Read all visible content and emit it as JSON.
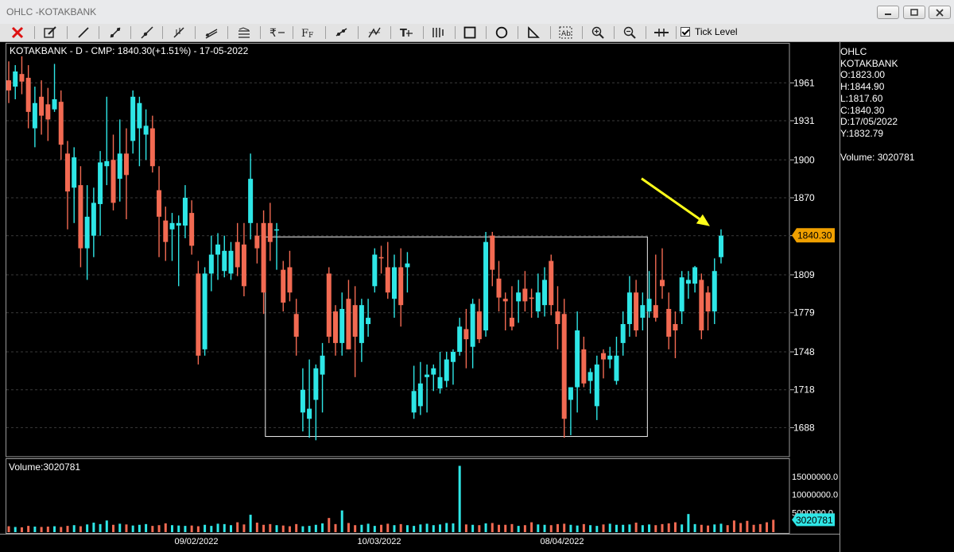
{
  "window": {
    "title": "OHLC -KOTAKBANK",
    "controls": [
      "minimize",
      "maximize",
      "close"
    ]
  },
  "toolbar": {
    "tools": [
      "close-icon",
      "pencil-icon",
      "line-icon",
      "ray-icon",
      "extended-line-icon",
      "fibonacci-icon",
      "channel-icon",
      "parallel-lines-icon",
      "rupee-icon",
      "font-icon",
      "tool-icon",
      "zigzag-icon",
      "text-icon",
      "gann-icon",
      "rectangle-icon",
      "ellipse-icon",
      "triangle-icon",
      "text-box-icon",
      "zoom-in-icon",
      "zoom-out-icon",
      "crosshair-icon"
    ],
    "tick_level_label": "Tick Level",
    "tick_level_checked": true
  },
  "info_panel": {
    "lines": [
      "OHLC",
      "KOTAKBANK",
      "O:1823.00",
      "H:1844.90",
      "L:1817.60",
      "C:1840.30",
      "D:17/05/2022",
      "Y:1832.79"
    ],
    "volume_line": "Volume: 3020781"
  },
  "chart_data": {
    "type": "candlestick",
    "title": "KOTAKBANK - D - CMP: 1840.30(+1.51%) - 17-05-2022",
    "price_axis": {
      "ticks": [
        1961,
        1931,
        1900,
        1870,
        1840,
        1809,
        1779,
        1748,
        1718,
        1688
      ],
      "range": [
        1665,
        1992
      ]
    },
    "last_price_label": "1840.30",
    "x_labels": [
      "09/02/2022",
      "10/03/2022",
      "08/04/2022"
    ],
    "volume_title": "Volume:3020781",
    "volume_axis": {
      "ticks": [
        "15000000.0",
        "10000000.0",
        "5000000.0"
      ],
      "range": [
        0,
        19000000
      ]
    },
    "last_volume_label": "3020781",
    "colors": {
      "up": "#2ee6e6",
      "down": "#f26a52",
      "grid": "#3a3a3a",
      "annotation": "#ffff1a",
      "price_tag": "#f0a000",
      "volume_tag": "#2ee6e6"
    },
    "annotation": {
      "kind": "arrow",
      "color": "#ffff1a",
      "target": "last candle"
    },
    "highlight_box": {
      "from_index": 40,
      "to_index": 97,
      "price_top": 1839,
      "price_bottom": 1681
    },
    "candles": [
      {
        "o": 1963,
        "h": 1978,
        "l": 1945,
        "c": 1955
      },
      {
        "o": 1958,
        "h": 1975,
        "l": 1948,
        "c": 1970
      },
      {
        "o": 1968,
        "h": 1982,
        "l": 1952,
        "c": 1962
      },
      {
        "o": 1965,
        "h": 1975,
        "l": 1925,
        "c": 1938
      },
      {
        "o": 1925,
        "h": 1958,
        "l": 1910,
        "c": 1945
      },
      {
        "o": 1950,
        "h": 1963,
        "l": 1920,
        "c": 1935
      },
      {
        "o": 1944,
        "h": 1957,
        "l": 1915,
        "c": 1932
      },
      {
        "o": 1940,
        "h": 1976,
        "l": 1938,
        "c": 1948
      },
      {
        "o": 1946,
        "h": 1955,
        "l": 1900,
        "c": 1912
      },
      {
        "o": 1905,
        "h": 1915,
        "l": 1845,
        "c": 1875
      },
      {
        "o": 1878,
        "h": 1910,
        "l": 1850,
        "c": 1902
      },
      {
        "o": 1880,
        "h": 1895,
        "l": 1815,
        "c": 1830
      },
      {
        "o": 1830,
        "h": 1880,
        "l": 1805,
        "c": 1855
      },
      {
        "o": 1840,
        "h": 1878,
        "l": 1823,
        "c": 1866
      },
      {
        "o": 1865,
        "h": 1907,
        "l": 1840,
        "c": 1898
      },
      {
        "o": 1895,
        "h": 1950,
        "l": 1880,
        "c": 1899
      },
      {
        "o": 1900,
        "h": 1920,
        "l": 1860,
        "c": 1866
      },
      {
        "o": 1885,
        "h": 1932,
        "l": 1867,
        "c": 1905
      },
      {
        "o": 1905,
        "h": 1925,
        "l": 1853,
        "c": 1888
      },
      {
        "o": 1915,
        "h": 1955,
        "l": 1905,
        "c": 1950
      },
      {
        "o": 1925,
        "h": 1950,
        "l": 1895,
        "c": 1945
      },
      {
        "o": 1920,
        "h": 1940,
        "l": 1900,
        "c": 1927
      },
      {
        "o": 1925,
        "h": 1935,
        "l": 1890,
        "c": 1895
      },
      {
        "o": 1876,
        "h": 1895,
        "l": 1823,
        "c": 1855
      },
      {
        "o": 1852,
        "h": 1863,
        "l": 1820,
        "c": 1835
      },
      {
        "o": 1845,
        "h": 1858,
        "l": 1820,
        "c": 1850
      },
      {
        "o": 1848,
        "h": 1856,
        "l": 1800,
        "c": 1850
      },
      {
        "o": 1848,
        "h": 1880,
        "l": 1838,
        "c": 1870
      },
      {
        "o": 1858,
        "h": 1868,
        "l": 1825,
        "c": 1832
      },
      {
        "o": 1810,
        "h": 1820,
        "l": 1738,
        "c": 1745
      },
      {
        "o": 1750,
        "h": 1815,
        "l": 1745,
        "c": 1810
      },
      {
        "o": 1810,
        "h": 1840,
        "l": 1796,
        "c": 1825
      },
      {
        "o": 1825,
        "h": 1842,
        "l": 1805,
        "c": 1833
      },
      {
        "o": 1812,
        "h": 1840,
        "l": 1807,
        "c": 1828
      },
      {
        "o": 1810,
        "h": 1835,
        "l": 1805,
        "c": 1828
      },
      {
        "o": 1835,
        "h": 1850,
        "l": 1808,
        "c": 1815
      },
      {
        "o": 1833,
        "h": 1850,
        "l": 1792,
        "c": 1800
      },
      {
        "o": 1850,
        "h": 1905,
        "l": 1837,
        "c": 1885
      },
      {
        "o": 1840,
        "h": 1850,
        "l": 1818,
        "c": 1830
      },
      {
        "o": 1850,
        "h": 1860,
        "l": 1778,
        "c": 1795
      },
      {
        "o": 1850,
        "h": 1866,
        "l": 1820,
        "c": 1835
      },
      {
        "o": 1845,
        "h": 1850,
        "l": 1813,
        "c": 1845
      },
      {
        "o": 1813,
        "h": 1820,
        "l": 1780,
        "c": 1787
      },
      {
        "o": 1815,
        "h": 1828,
        "l": 1788,
        "c": 1795
      },
      {
        "o": 1778,
        "h": 1790,
        "l": 1745,
        "c": 1760
      },
      {
        "o": 1700,
        "h": 1735,
        "l": 1685,
        "c": 1718
      },
      {
        "o": 1695,
        "h": 1742,
        "l": 1680,
        "c": 1703
      },
      {
        "o": 1710,
        "h": 1738,
        "l": 1678,
        "c": 1735
      },
      {
        "o": 1730,
        "h": 1755,
        "l": 1700,
        "c": 1745
      },
      {
        "o": 1810,
        "h": 1815,
        "l": 1755,
        "c": 1760
      },
      {
        "o": 1780,
        "h": 1785,
        "l": 1745,
        "c": 1755
      },
      {
        "o": 1755,
        "h": 1795,
        "l": 1745,
        "c": 1782
      },
      {
        "o": 1790,
        "h": 1805,
        "l": 1750,
        "c": 1750
      },
      {
        "o": 1785,
        "h": 1800,
        "l": 1728,
        "c": 1760
      },
      {
        "o": 1755,
        "h": 1790,
        "l": 1740,
        "c": 1785
      },
      {
        "o": 1770,
        "h": 1790,
        "l": 1760,
        "c": 1775
      },
      {
        "o": 1800,
        "h": 1830,
        "l": 1795,
        "c": 1825
      },
      {
        "o": 1823,
        "h": 1832,
        "l": 1810,
        "c": 1822
      },
      {
        "o": 1815,
        "h": 1835,
        "l": 1790,
        "c": 1795
      },
      {
        "o": 1790,
        "h": 1825,
        "l": 1775,
        "c": 1815
      },
      {
        "o": 1815,
        "h": 1830,
        "l": 1768,
        "c": 1785
      },
      {
        "o": 1815,
        "h": 1827,
        "l": 1795,
        "c": 1818
      },
      {
        "o": 1700,
        "h": 1737,
        "l": 1695,
        "c": 1717
      },
      {
        "o": 1705,
        "h": 1740,
        "l": 1698,
        "c": 1723
      },
      {
        "o": 1728,
        "h": 1738,
        "l": 1700,
        "c": 1730
      },
      {
        "o": 1730,
        "h": 1738,
        "l": 1717,
        "c": 1735
      },
      {
        "o": 1719,
        "h": 1748,
        "l": 1715,
        "c": 1728
      },
      {
        "o": 1725,
        "h": 1748,
        "l": 1720,
        "c": 1742
      },
      {
        "o": 1740,
        "h": 1750,
        "l": 1722,
        "c": 1748
      },
      {
        "o": 1748,
        "h": 1775,
        "l": 1745,
        "c": 1768
      },
      {
        "o": 1766,
        "h": 1782,
        "l": 1735,
        "c": 1758
      },
      {
        "o": 1752,
        "h": 1790,
        "l": 1735,
        "c": 1786
      },
      {
        "o": 1780,
        "h": 1790,
        "l": 1755,
        "c": 1758
      },
      {
        "o": 1765,
        "h": 1843,
        "l": 1760,
        "c": 1835
      },
      {
        "o": 1840,
        "h": 1843,
        "l": 1800,
        "c": 1813
      },
      {
        "o": 1806,
        "h": 1820,
        "l": 1780,
        "c": 1791
      },
      {
        "o": 1790,
        "h": 1795,
        "l": 1765,
        "c": 1788
      },
      {
        "o": 1775,
        "h": 1800,
        "l": 1765,
        "c": 1768
      },
      {
        "o": 1788,
        "h": 1805,
        "l": 1771,
        "c": 1795
      },
      {
        "o": 1798,
        "h": 1812,
        "l": 1780,
        "c": 1788
      },
      {
        "o": 1791,
        "h": 1798,
        "l": 1775,
        "c": 1790
      },
      {
        "o": 1780,
        "h": 1810,
        "l": 1775,
        "c": 1795
      },
      {
        "o": 1785,
        "h": 1815,
        "l": 1776,
        "c": 1805
      },
      {
        "o": 1820,
        "h": 1825,
        "l": 1777,
        "c": 1785
      },
      {
        "o": 1780,
        "h": 1800,
        "l": 1750,
        "c": 1770
      },
      {
        "o": 1778,
        "h": 1790,
        "l": 1680,
        "c": 1695
      },
      {
        "o": 1710,
        "h": 1720,
        "l": 1682,
        "c": 1720
      },
      {
        "o": 1720,
        "h": 1780,
        "l": 1700,
        "c": 1765
      },
      {
        "o": 1750,
        "h": 1760,
        "l": 1720,
        "c": 1723
      },
      {
        "o": 1725,
        "h": 1735,
        "l": 1715,
        "c": 1732
      },
      {
        "o": 1705,
        "h": 1745,
        "l": 1694,
        "c": 1738
      },
      {
        "o": 1747,
        "h": 1750,
        "l": 1727,
        "c": 1742
      },
      {
        "o": 1742,
        "h": 1752,
        "l": 1735,
        "c": 1745
      },
      {
        "o": 1725,
        "h": 1760,
        "l": 1722,
        "c": 1745
      },
      {
        "o": 1755,
        "h": 1780,
        "l": 1745,
        "c": 1770
      },
      {
        "o": 1770,
        "h": 1808,
        "l": 1760,
        "c": 1795
      },
      {
        "o": 1795,
        "h": 1805,
        "l": 1760,
        "c": 1765
      },
      {
        "o": 1775,
        "h": 1795,
        "l": 1765,
        "c": 1785
      },
      {
        "o": 1780,
        "h": 1812,
        "l": 1775,
        "c": 1790
      },
      {
        "o": 1785,
        "h": 1825,
        "l": 1772,
        "c": 1775
      },
      {
        "o": 1805,
        "h": 1830,
        "l": 1790,
        "c": 1800
      },
      {
        "o": 1782,
        "h": 1795,
        "l": 1750,
        "c": 1760
      },
      {
        "o": 1770,
        "h": 1780,
        "l": 1743,
        "c": 1765
      },
      {
        "o": 1780,
        "h": 1812,
        "l": 1770,
        "c": 1807
      },
      {
        "o": 1802,
        "h": 1812,
        "l": 1790,
        "c": 1805
      },
      {
        "o": 1802,
        "h": 1816,
        "l": 1795,
        "c": 1815
      },
      {
        "o": 1805,
        "h": 1810,
        "l": 1758,
        "c": 1765
      },
      {
        "o": 1795,
        "h": 1800,
        "l": 1765,
        "c": 1780
      },
      {
        "o": 1780,
        "h": 1822,
        "l": 1770,
        "c": 1812
      },
      {
        "o": 1823,
        "h": 1845,
        "l": 1818,
        "c": 1840
      }
    ],
    "volumes": [
      1.2,
      1.0,
      0.9,
      1.3,
      1.1,
      1.0,
      1.1,
      1.2,
      1.0,
      1.3,
      1.5,
      1.2,
      1.7,
      2.2,
      1.8,
      2.8,
      1.6,
      1.9,
      1.7,
      1.4,
      1.6,
      1.8,
      1.3,
      1.5,
      2.0,
      1.5,
      1.4,
      1.3,
      1.4,
      1.2,
      1.6,
      1.3,
      1.9,
      1.8,
      1.5,
      2.3,
      1.7,
      4.4,
      2.2,
      1.6,
      1.8,
      1.5,
      1.4,
      1.2,
      1.8,
      1.2,
      1.3,
      1.6,
      2.0,
      3.5,
      1.8,
      5.6,
      2.1,
      1.5,
      1.6,
      1.9,
      1.3,
      1.6,
      1.9,
      1.5,
      1.8,
      1.5,
      1.3,
      1.7,
      1.9,
      1.5,
      1.7,
      2.1,
      2.0,
      18.0,
      1.7,
      1.6,
      1.5,
      2.0,
      2.1,
      1.6,
      1.6,
      1.8,
      1.3,
      1.5,
      2.3,
      1.7,
      1.6,
      1.5,
      1.8,
      1.9,
      1.6,
      1.4,
      1.8,
      1.5,
      1.3,
      1.7,
      1.9,
      1.6,
      1.6,
      1.7,
      2.2,
      1.5,
      1.7,
      1.5,
      1.8,
      2.0,
      2.3,
      1.7,
      4.6,
      1.8,
      1.6,
      1.4,
      1.7,
      1.9,
      1.5,
      2.8,
      2.1,
      2.7,
      1.6,
      1.8,
      2.3,
      3.0
    ]
  }
}
